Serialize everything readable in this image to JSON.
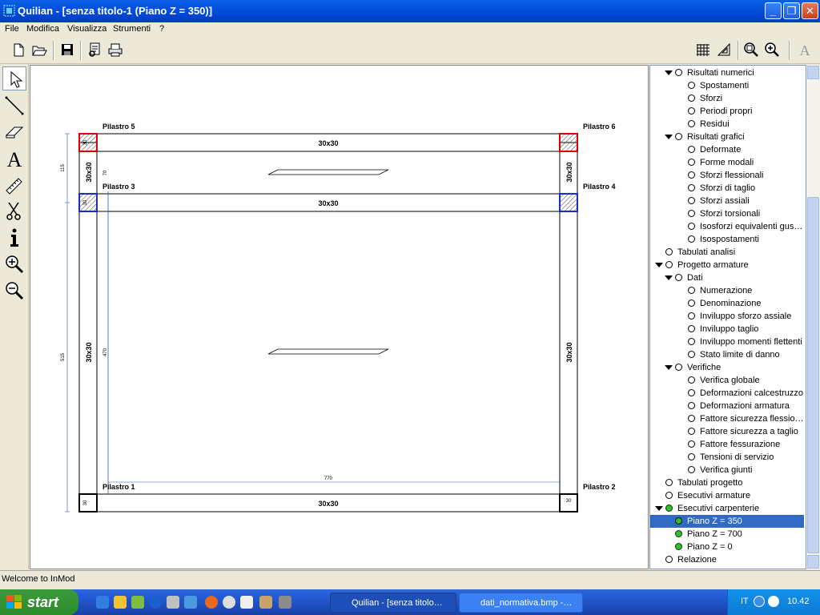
{
  "window": {
    "title": "Quilian - [senza titolo-1 (Piano Z = 350)]"
  },
  "menu": [
    "File",
    "Modifica",
    "Visualizza",
    "Strumenti",
    "?"
  ],
  "toolbar_left": [
    "new-file-icon",
    "open-folder-icon",
    "save-icon",
    "print-preview-icon",
    "print-icon"
  ],
  "toolbar_right": [
    "grid-icon",
    "set-square-icon",
    "zoom-window-icon",
    "zoom-in-icon",
    "text-icon"
  ],
  "left_tools": [
    "pointer-icon",
    "line-icon",
    "eraser-icon",
    "text-tool-icon",
    "measure-icon",
    "cut-icon",
    "info-icon",
    "zoom-in-icon",
    "zoom-out-icon"
  ],
  "drawing": {
    "pillars": [
      "Pilastro 5",
      "Pilastro 6",
      "Pilastro 3",
      "Pilastro 4",
      "Pilastro 1",
      "Pilastro 2"
    ],
    "beam_label": "30x30",
    "pillar_section_label": "30",
    "dimensions": {
      "d115": "115",
      "d515": "515",
      "d70": "70",
      "d470": "470",
      "d770": "770"
    }
  },
  "tree": [
    {
      "label": "Risultati numerici",
      "level": 1,
      "arrow": true
    },
    {
      "label": "Spostamenti",
      "level": 2
    },
    {
      "label": "Sforzi",
      "level": 2
    },
    {
      "label": "Periodi propri",
      "level": 2
    },
    {
      "label": "Residui",
      "level": 2
    },
    {
      "label": "Risultati grafici",
      "level": 1,
      "arrow": true
    },
    {
      "label": "Deformate",
      "level": 2
    },
    {
      "label": "Forme modali",
      "level": 2
    },
    {
      "label": "Sforzi flessionali",
      "level": 2
    },
    {
      "label": "Sforzi di taglio",
      "level": 2
    },
    {
      "label": "Sforzi assiali",
      "level": 2
    },
    {
      "label": "Sforzi torsionali",
      "level": 2
    },
    {
      "label": "Isosforzi equivalenti gus…",
      "level": 2
    },
    {
      "label": "Isospostamenti",
      "level": 2
    },
    {
      "label": "Tabulati analisi",
      "level": 0
    },
    {
      "label": "Progetto armature",
      "level": 0,
      "arrow": true
    },
    {
      "label": "Dati",
      "level": 1,
      "arrow": true
    },
    {
      "label": "Numerazione",
      "level": 2
    },
    {
      "label": "Denominazione",
      "level": 2
    },
    {
      "label": "Inviluppo sforzo assiale",
      "level": 2
    },
    {
      "label": "Inviluppo taglio",
      "level": 2
    },
    {
      "label": "Inviluppo momenti flettenti",
      "level": 2
    },
    {
      "label": "Stato limite di danno",
      "level": 2
    },
    {
      "label": "Verifiche",
      "level": 1,
      "arrow": true
    },
    {
      "label": "Verifica globale",
      "level": 2
    },
    {
      "label": "Deformazioni calcestruzzo",
      "level": 2
    },
    {
      "label": "Deformazioni armatura",
      "level": 2
    },
    {
      "label": "Fattore sicurezza flessio…",
      "level": 2
    },
    {
      "label": "Fattore sicurezza a taglio",
      "level": 2
    },
    {
      "label": "Fattore fessurazione",
      "level": 2
    },
    {
      "label": "Tensioni di servizio",
      "level": 2
    },
    {
      "label": "Verifica giunti",
      "level": 2
    },
    {
      "label": "Tabulati progetto",
      "level": 0
    },
    {
      "label": "Esecutivi armature",
      "level": 0
    },
    {
      "label": "Esecutivi carpenterie",
      "level": 0,
      "arrow": true,
      "green": true
    },
    {
      "label": "Piano Z = 350",
      "level": 1,
      "green": true,
      "selected": true
    },
    {
      "label": "Piano Z = 700",
      "level": 1,
      "green": true
    },
    {
      "label": "Piano Z = 0",
      "level": 1,
      "green": true
    },
    {
      "label": "Relazione",
      "level": 0
    }
  ],
  "status": {
    "text": "Welcome to InMod"
  },
  "taskbar": {
    "start": "start",
    "tasks": [
      "Quilian - [senza titolo…",
      "dati_normativa.bmp -…"
    ],
    "lang": "IT",
    "clock": "10.42"
  }
}
